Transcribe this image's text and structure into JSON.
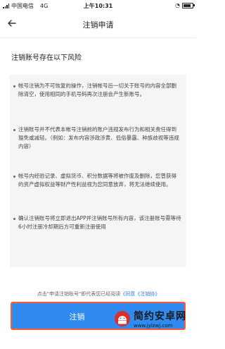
{
  "status_bar": {
    "carrier": "中国电信",
    "network": "4G",
    "time": "上午10:31"
  },
  "nav": {
    "back_icon": "back-arrow-icon",
    "title": "注销申请"
  },
  "card": {
    "title": "注销账号存在以下风险",
    "risks": [
      "帐号注销为不可恢复的操作，注销帐号后一切关于账号的内容全部删除清空，使用相同的手机号码再次注册会产生新账号。",
      "注销账号并不代表本帐号注销前的账户违规发布行为和相关责任得到豁免或减轻。（例如：发布内容涉政涉黄、低俗暴露、种族歧视等违规内容）",
      "帐号内经验记录、虚拟货币、积分数据等将被作废及删除，您曾获得的资产虚拟权益等财产性利益视为您同意放弃，将无法继续使用。",
      "确认注销账号将立即退出APP并注销账号所有内容，该注册账号需等待6小时注册冷却期后方可重新注册使用"
    ]
  },
  "footer": {
    "hint_prefix": "点击\"申请注销账号\"即代表您已经阅读",
    "hint_link": "《同意《注销协》",
    "submit_label": "注销"
  },
  "watermark": {
    "main": "简约安卓网",
    "sub": "www.jylzwj.com"
  },
  "colors": {
    "primary": "#2f8bf0",
    "highlight_border": "#ff5a2e",
    "risk_bg": "#f5f5f5"
  }
}
